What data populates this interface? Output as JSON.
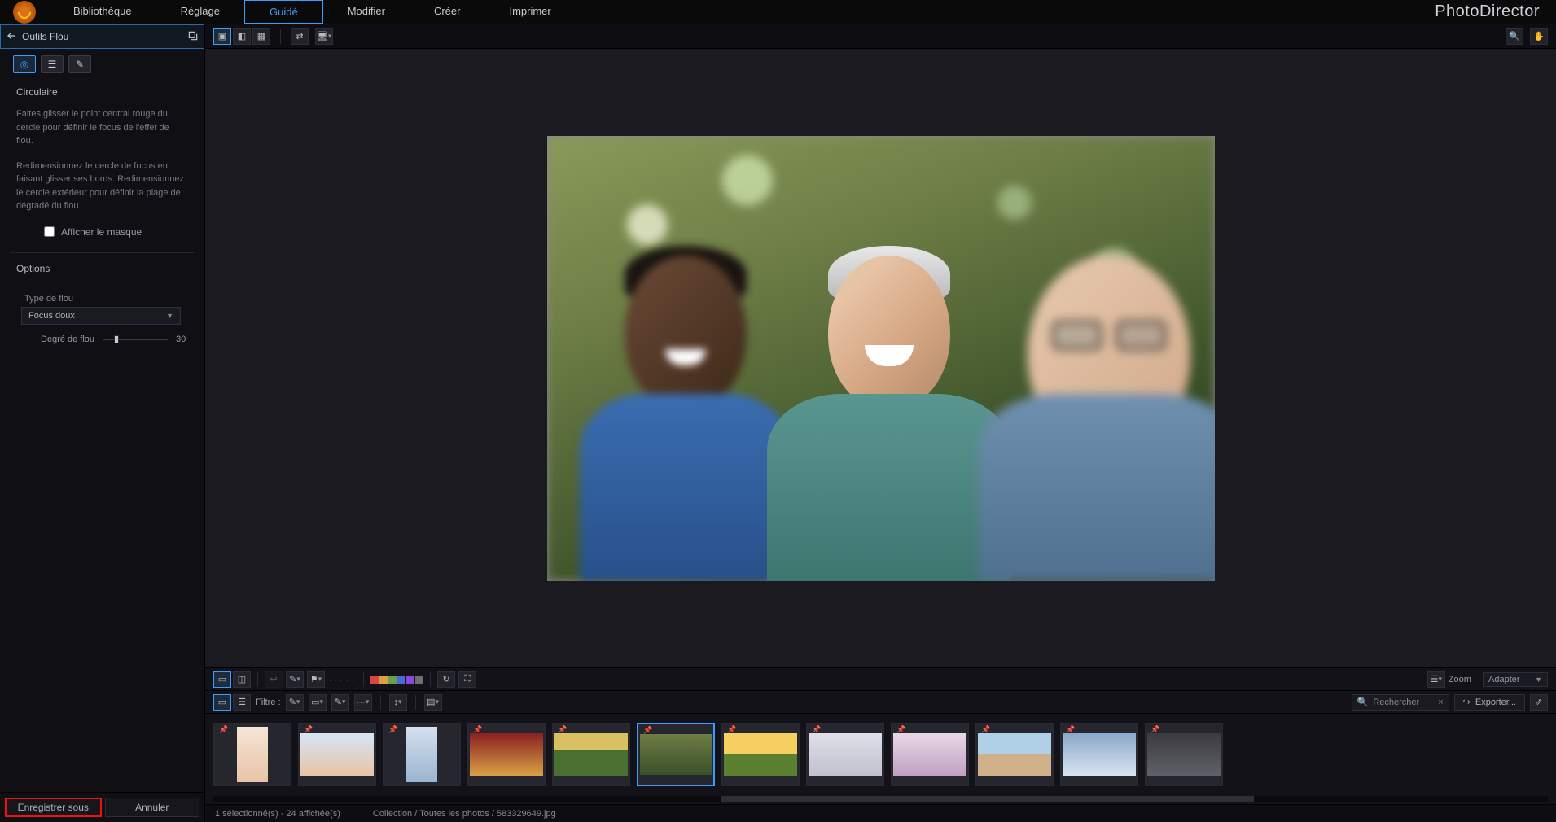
{
  "app_title": "PhotoDirector",
  "top_tabs": [
    "Bibliothèque",
    "Réglage",
    "Guidé",
    "Modifier",
    "Créer",
    "Imprimer"
  ],
  "top_active_index": 2,
  "left": {
    "title": "Outils Flou",
    "section": "Circulaire",
    "desc1": "Faites glisser le point central rouge du cercle pour définir le focus de l'effet de flou.",
    "desc2": "Redimensionnez le cercle de focus en faisant glisser ses bords. Redimensionnez le cercle extérieur pour définir la plage de dégradé du flou.",
    "checkbox": "Afficher le masque",
    "options_label": "Options",
    "blur_type_label": "Type de flou",
    "blur_type_value": "Focus doux",
    "degree_label": "Degré de flou",
    "degree_value": "30",
    "save_as": "Enregistrer sous",
    "cancel": "Annuler"
  },
  "filter_label": "Filtre :",
  "search_placeholder": "Rechercher",
  "export_label": "Exporter...",
  "zoom_label": "Zoom :",
  "zoom_value": "Adapter",
  "colors": [
    "#d94545",
    "#d9a045",
    "#6aa04a",
    "#4a6ad9",
    "#8a4ad9",
    "#707070"
  ],
  "thumbnails": [
    {
      "orient": "portrait",
      "bg": "linear-gradient(#f5e5d5,#e8c4a6)"
    },
    {
      "orient": "landscape",
      "bg": "linear-gradient(#d5e5f5,#e8c4a6)"
    },
    {
      "orient": "portrait",
      "bg": "linear-gradient(#d5e0f0,#9ab4d0)"
    },
    {
      "orient": "landscape",
      "bg": "linear-gradient(#8a2020,#d9a045)"
    },
    {
      "orient": "landscape",
      "bg": "linear-gradient(#d9c060 40%,#4a7030 40%)"
    },
    {
      "orient": "landscape",
      "bg": "linear-gradient(#6d7d45,#3a5028)",
      "selected": true
    },
    {
      "orient": "landscape",
      "bg": "linear-gradient(#f5d060 50%,#5a8030 50%)"
    },
    {
      "orient": "landscape",
      "bg": "linear-gradient(#e0e0e8,#c0c0d0)"
    },
    {
      "orient": "landscape",
      "bg": "linear-gradient(#e8d8e8,#c0a0c0)"
    },
    {
      "orient": "landscape",
      "bg": "linear-gradient(#b0d0e8 50%,#d0b088 50%)"
    },
    {
      "orient": "landscape",
      "bg": "linear-gradient(#8aa8c8,#d8e4f0)"
    },
    {
      "orient": "landscape",
      "bg": "linear-gradient(#3a3a40,#606068)"
    }
  ],
  "status": {
    "selection": "1 sélectionné(s) - 24 affichée(s)",
    "path": "Collection / Toutes les photos / 583329649.jpg"
  }
}
